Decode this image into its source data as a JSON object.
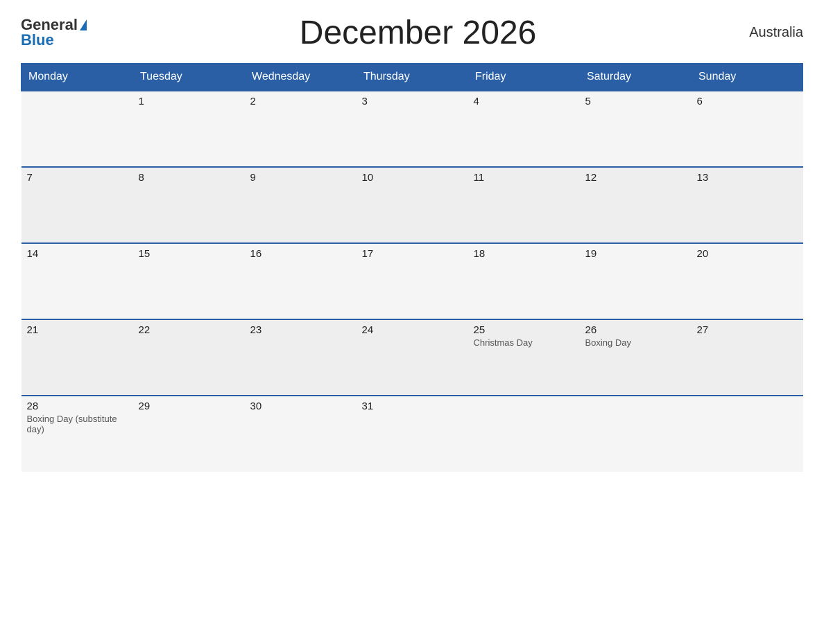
{
  "header": {
    "logo_general": "General",
    "logo_blue": "Blue",
    "title": "December 2026",
    "country": "Australia"
  },
  "weekdays": [
    "Monday",
    "Tuesday",
    "Wednesday",
    "Thursday",
    "Friday",
    "Saturday",
    "Sunday"
  ],
  "rows": [
    [
      {
        "day": "",
        "holiday": ""
      },
      {
        "day": "1",
        "holiday": ""
      },
      {
        "day": "2",
        "holiday": ""
      },
      {
        "day": "3",
        "holiday": ""
      },
      {
        "day": "4",
        "holiday": ""
      },
      {
        "day": "5",
        "holiday": ""
      },
      {
        "day": "6",
        "holiday": ""
      }
    ],
    [
      {
        "day": "7",
        "holiday": ""
      },
      {
        "day": "8",
        "holiday": ""
      },
      {
        "day": "9",
        "holiday": ""
      },
      {
        "day": "10",
        "holiday": ""
      },
      {
        "day": "11",
        "holiday": ""
      },
      {
        "day": "12",
        "holiday": ""
      },
      {
        "day": "13",
        "holiday": ""
      }
    ],
    [
      {
        "day": "14",
        "holiday": ""
      },
      {
        "day": "15",
        "holiday": ""
      },
      {
        "day": "16",
        "holiday": ""
      },
      {
        "day": "17",
        "holiday": ""
      },
      {
        "day": "18",
        "holiday": ""
      },
      {
        "day": "19",
        "holiday": ""
      },
      {
        "day": "20",
        "holiday": ""
      }
    ],
    [
      {
        "day": "21",
        "holiday": ""
      },
      {
        "day": "22",
        "holiday": ""
      },
      {
        "day": "23",
        "holiday": ""
      },
      {
        "day": "24",
        "holiday": ""
      },
      {
        "day": "25",
        "holiday": "Christmas Day"
      },
      {
        "day": "26",
        "holiday": "Boxing Day"
      },
      {
        "day": "27",
        "holiday": ""
      }
    ],
    [
      {
        "day": "28",
        "holiday": "Boxing Day (substitute day)"
      },
      {
        "day": "29",
        "holiday": ""
      },
      {
        "day": "30",
        "holiday": ""
      },
      {
        "day": "31",
        "holiday": ""
      },
      {
        "day": "",
        "holiday": ""
      },
      {
        "day": "",
        "holiday": ""
      },
      {
        "day": "",
        "holiday": ""
      }
    ]
  ]
}
